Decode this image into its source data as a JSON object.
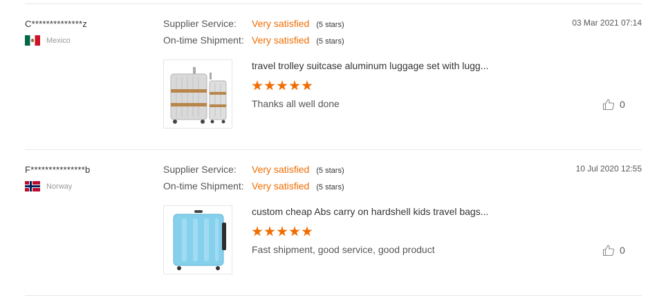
{
  "reviews": [
    {
      "user": "C**************z",
      "country": "Mexico",
      "supplier_label": "Supplier Service:",
      "supplier_value": "Very satisfied",
      "supplier_stars": "(5 stars)",
      "shipment_label": "On-time Shipment:",
      "shipment_value": "Very satisfied",
      "shipment_stars": "(5 stars)",
      "date": "03 Mar 2021 07:14",
      "product_icon": "aluminum-luggage-set-image",
      "product": "travel trolley suitcase aluminum luggage set with lugg...",
      "rating": 5,
      "comment": "Thanks all well done",
      "likes": "0"
    },
    {
      "user": "F***************b",
      "country": "Norway",
      "supplier_label": "Supplier Service:",
      "supplier_value": "Very satisfied",
      "supplier_stars": "(5 stars)",
      "shipment_label": "On-time Shipment:",
      "shipment_value": "Very satisfied",
      "shipment_stars": "(5 stars)",
      "date": "10 Jul 2020 12:55",
      "product_icon": "blue-hardshell-suitcase-image",
      "product": "custom cheap Abs carry on hardshell kids travel bags...",
      "rating": 5,
      "comment": "Fast shipment, good service, good product",
      "likes": "0"
    }
  ],
  "colors": {
    "accent": "#f06c00",
    "divider": "#e6e6e6",
    "muted": "#999999"
  }
}
